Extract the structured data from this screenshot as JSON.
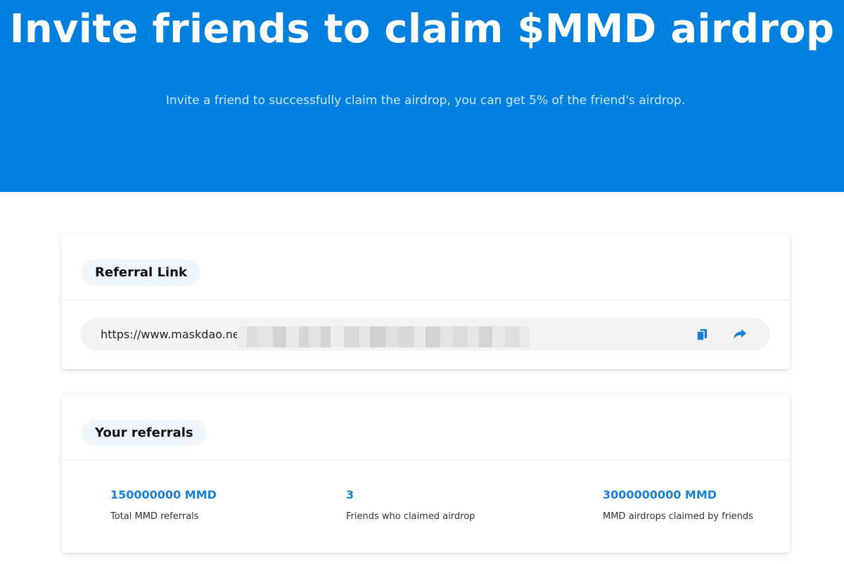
{
  "hero": {
    "title": "Invite friends to claim $MMD airdrop",
    "subtitle": "Invite a friend to successfully claim the airdrop, you can get 5% of the friend's airdrop."
  },
  "referral_card": {
    "heading": "Referral Link",
    "link_text": "https://www.maskdao.ne",
    "copy_icon": "copy-icon",
    "share_icon": "share-icon"
  },
  "referrals_card": {
    "heading": "Your referrals",
    "stats": [
      {
        "value": "150000000 MMD",
        "label": "Total MMD referrals"
      },
      {
        "value": "3",
        "label": "Friends who claimed airdrop"
      },
      {
        "value": "3000000000 MMD",
        "label": "MMD airdrops claimed by friends"
      }
    ]
  },
  "colors": {
    "hero_background": "#0080de",
    "accent": "#1a7fd6",
    "pill_background": "#eef6fe",
    "link_bar_background": "#f3f3f3"
  }
}
